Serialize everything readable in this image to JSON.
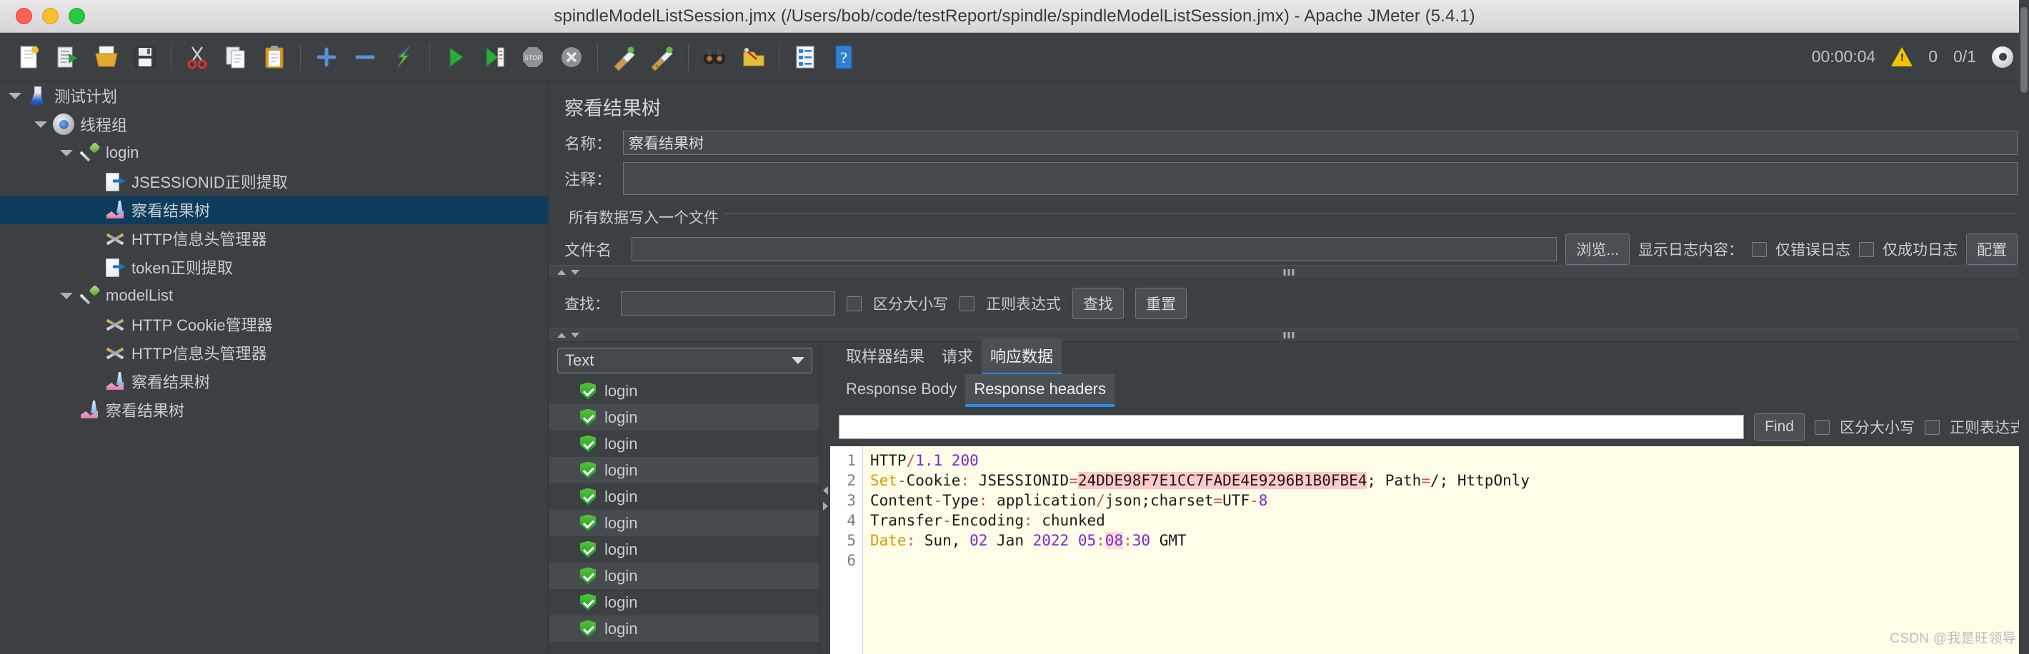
{
  "window": {
    "title": "spindleModelListSession.jmx (/Users/bob/code/testReport/spindle/spindleModelListSession.jmx) - Apache JMeter (5.4.1)"
  },
  "toolbar": {
    "icons": [
      {
        "name": "new-icon"
      },
      {
        "name": "templates-icon"
      },
      {
        "name": "open-icon"
      },
      {
        "name": "save-icon"
      },
      {
        "name": "cut-icon"
      },
      {
        "name": "copy-icon"
      },
      {
        "name": "paste-icon"
      },
      {
        "name": "expand-all-icon"
      },
      {
        "name": "collapse-all-icon"
      },
      {
        "name": "toggle-icon"
      },
      {
        "name": "start-icon"
      },
      {
        "name": "start-no-pause-icon"
      },
      {
        "name": "stop-icon"
      },
      {
        "name": "shutdown-icon"
      },
      {
        "name": "clear-icon"
      },
      {
        "name": "clear-all-icon"
      },
      {
        "name": "search-icon"
      },
      {
        "name": "search-reset-icon"
      },
      {
        "name": "function-helper-icon"
      },
      {
        "name": "help-icon"
      }
    ],
    "elapsed": "00:00:04",
    "warning_count": "0",
    "thread_count": "0/1"
  },
  "tree": {
    "nodes": [
      {
        "label": "测试计划",
        "icon": "flask-icon",
        "depth": 0,
        "twisty": "open",
        "selected": false
      },
      {
        "label": "线程组",
        "icon": "gear-icon",
        "depth": 1,
        "twisty": "open",
        "selected": false
      },
      {
        "label": "login",
        "icon": "pipette-icon",
        "depth": 2,
        "twisty": "open",
        "selected": false
      },
      {
        "label": "JSESSIONID正则提取",
        "icon": "extract-icon",
        "depth": 3,
        "twisty": "none",
        "selected": false
      },
      {
        "label": "察看结果树",
        "icon": "chart-icon",
        "depth": 3,
        "twisty": "none",
        "selected": true
      },
      {
        "label": "HTTP信息头管理器",
        "icon": "tools-icon",
        "depth": 3,
        "twisty": "none",
        "selected": false
      },
      {
        "label": "token正则提取",
        "icon": "extract-icon",
        "depth": 3,
        "twisty": "none",
        "selected": false
      },
      {
        "label": "modelList",
        "icon": "pipette-icon",
        "depth": 2,
        "twisty": "open",
        "selected": false
      },
      {
        "label": "HTTP Cookie管理器",
        "icon": "tools-icon",
        "depth": 3,
        "twisty": "none",
        "selected": false
      },
      {
        "label": "HTTP信息头管理器",
        "icon": "tools-icon",
        "depth": 3,
        "twisty": "none",
        "selected": false
      },
      {
        "label": "察看结果树",
        "icon": "chart-icon",
        "depth": 3,
        "twisty": "none",
        "selected": false
      },
      {
        "label": "察看结果树",
        "icon": "chart-icon",
        "depth": 2,
        "twisty": "none",
        "selected": false
      }
    ]
  },
  "panel": {
    "title": "察看结果树",
    "name_label": "名称：",
    "name_value": "察看结果树",
    "comment_label": "注释：",
    "comment_value": "",
    "group_title": "所有数据写入一个文件",
    "filename_label": "文件名",
    "filename_value": "",
    "browse_button": "浏览...",
    "log_display_label": "显示日志内容：",
    "errors_only_label": "仅错误日志",
    "success_only_label": "仅成功日志",
    "configure_button": "配置"
  },
  "search": {
    "label": "查找：",
    "value": "",
    "case_label": "区分大小写",
    "regex_label": "正则表达式",
    "find_button": "查找",
    "reset_button": "重置"
  },
  "results": {
    "renderer_selected": "Text",
    "items": [
      {
        "label": "login",
        "status": "success"
      },
      {
        "label": "login",
        "status": "success"
      },
      {
        "label": "login",
        "status": "success"
      },
      {
        "label": "login",
        "status": "success"
      },
      {
        "label": "login",
        "status": "success"
      },
      {
        "label": "login",
        "status": "success"
      },
      {
        "label": "login",
        "status": "success"
      },
      {
        "label": "login",
        "status": "success"
      },
      {
        "label": "login",
        "status": "success"
      },
      {
        "label": "login",
        "status": "success"
      }
    ]
  },
  "detail": {
    "tabs": [
      {
        "label": "取样器结果",
        "active": false
      },
      {
        "label": "请求",
        "active": false
      },
      {
        "label": "响应数据",
        "active": true
      }
    ],
    "subtabs": [
      {
        "label": "Response Body",
        "active": false
      },
      {
        "label": "Response headers",
        "active": true
      }
    ],
    "find": {
      "value": "",
      "button": "Find",
      "case_label": "区分大小写",
      "regex_label": "正则表达式"
    },
    "code": {
      "line_numbers": [
        "1",
        "2",
        "3",
        "4",
        "5",
        "6"
      ],
      "lines": [
        "HTTP/1.1 200",
        "Set-Cookie: JSESSIONID=24DDE98F7E1CC7FADE4E9296B1B0FBE4; Path=/; HttpOnly",
        "Content-Type: application/json;charset=UTF-8",
        "Transfer-Encoding: chunked",
        "Date: Sun, 02 Jan 2022 05:08:30 GMT",
        ""
      ],
      "highlighted_cookie": "24DDE98F7E1CC7FADE4E9296B1B0FBE4",
      "highlighted_time_part": "08"
    }
  },
  "watermark": "CSDN @我是旺领导",
  "colors": {
    "accent": "#2a8ae0",
    "selection": "#0d3c5c",
    "background": "#3c4043",
    "code_background": "#fffde8",
    "highlight": "#ffc9c9",
    "success": "#28a034",
    "warning": "#f3c300"
  }
}
